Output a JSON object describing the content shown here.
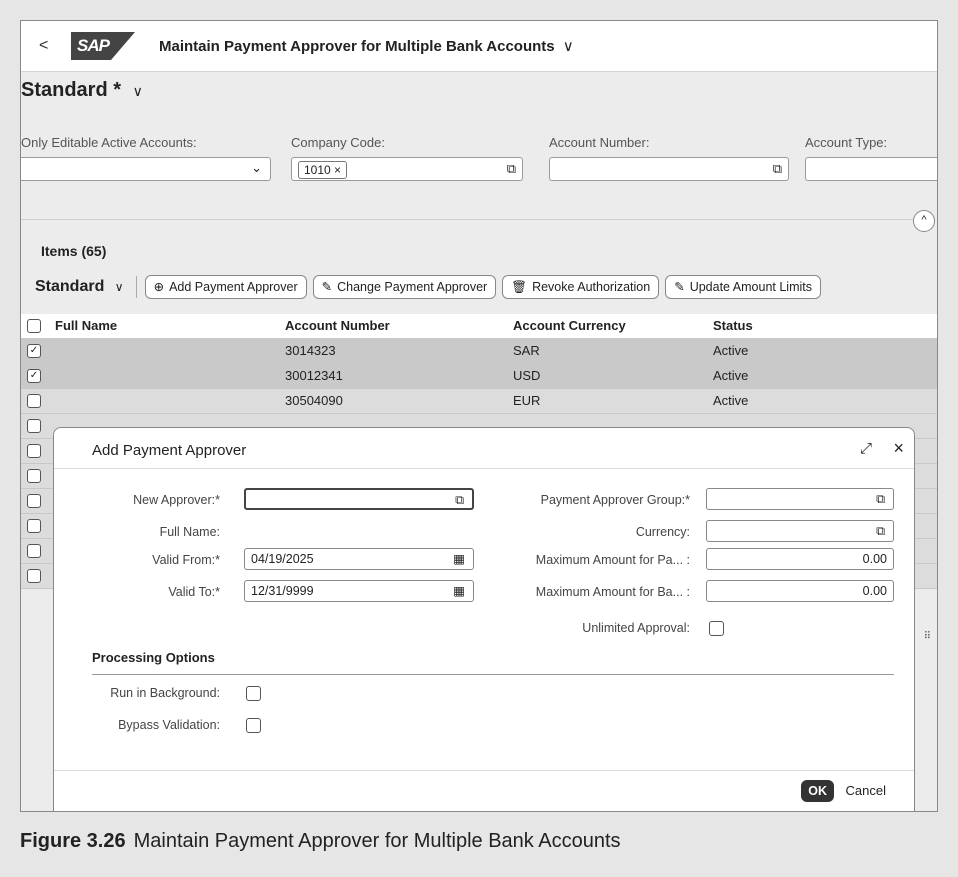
{
  "shell": {
    "back_label": "<",
    "logo_text": "SAP",
    "app_title": "Maintain Payment Approver for Multiple Bank Accounts",
    "title_chevron": "∨"
  },
  "header": {
    "variant": "Standard *",
    "variant_chevron": "∨",
    "filters": [
      {
        "label": "Only Editable Active Accounts:",
        "value": ""
      },
      {
        "label": "Company Code:",
        "value": "1010"
      },
      {
        "label": "Account Number:",
        "value": ""
      },
      {
        "label": "Account Type:",
        "value": ""
      }
    ],
    "token_remove": "×",
    "collapse_icon": "^"
  },
  "table": {
    "title": "Items (65)",
    "variant": "Standard",
    "variant_chevron": "∨",
    "buttons": [
      {
        "label": "Add Payment Approver",
        "icon": "add-approver-icon"
      },
      {
        "label": "Change Payment Approver",
        "icon": "pencil-icon"
      },
      {
        "label": "Revoke Authorization",
        "icon": "trash-icon"
      },
      {
        "label": "Update Amount Limits",
        "icon": "pencil-icon"
      }
    ],
    "columns": [
      "Full Name",
      "Account Number",
      "Account Currency",
      "Status"
    ],
    "rows": [
      {
        "selected": true,
        "full_name": "",
        "account_number": "3014323",
        "currency": "SAR",
        "status": "Active"
      },
      {
        "selected": true,
        "full_name": "",
        "account_number": "30012341",
        "currency": "USD",
        "status": "Active"
      },
      {
        "selected": false,
        "full_name": "",
        "account_number": "30504090",
        "currency": "EUR",
        "status": "Active"
      }
    ]
  },
  "dialog": {
    "title": "Add Payment Approver",
    "left_fields": [
      {
        "label": "New Approver:*",
        "value": ""
      },
      {
        "label": "Full Name:",
        "value": ""
      },
      {
        "label": "Valid From:*",
        "value": "04/19/2025"
      },
      {
        "label": "Valid To:*",
        "value": "12/31/9999"
      }
    ],
    "right_fields": [
      {
        "label": "Payment Approver Group:*",
        "value": ""
      },
      {
        "label": "Currency:",
        "value": ""
      },
      {
        "label": "Maximum Amount for Pa... :",
        "value": "0.00"
      },
      {
        "label": "Maximum Amount for Ba... :",
        "value": "0.00"
      }
    ],
    "unlimited_label": "Unlimited Approval:",
    "processing_title": "Processing Options",
    "run_background_label": "Run in Background:",
    "bypass_label": "Bypass Validation:",
    "ok_label": "OK",
    "cancel_label": "Cancel"
  },
  "caption": {
    "number": "Figure 3.26",
    "text": "Maintain Payment Approver for Multiple Bank Accounts"
  },
  "colors": {
    "logo": "#444444",
    "ok_button": "#333333",
    "selected_row": "#c9c9c9"
  }
}
